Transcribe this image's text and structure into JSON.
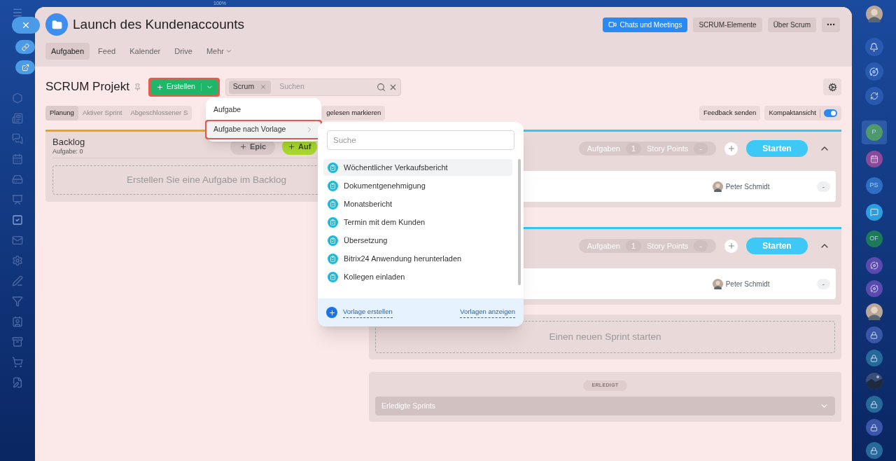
{
  "zoom_label": "100%",
  "project": {
    "title": "Launch des Kundenaccounts"
  },
  "header_buttons": [
    {
      "label": "Chats und Meetings",
      "kind": "primary"
    },
    {
      "label": "SCRUM-Elemente",
      "kind": "plain"
    },
    {
      "label": "Über Scrum",
      "kind": "plain"
    }
  ],
  "nav_tabs": [
    {
      "label": "Aufgaben",
      "selected": true,
      "dropdown": false
    },
    {
      "label": "Feed",
      "selected": false,
      "dropdown": false
    },
    {
      "label": "Kalender",
      "selected": false,
      "dropdown": false
    },
    {
      "label": "Drive",
      "selected": false,
      "dropdown": false
    },
    {
      "label": "Mehr",
      "selected": false,
      "dropdown": true
    }
  ],
  "page_title": "SCRUM Projekt",
  "create_button": {
    "label": "Erstellen",
    "highlighted": true
  },
  "search": {
    "filter_tag": "Scrum",
    "placeholder": "Suchen"
  },
  "view_tabs": [
    {
      "label": "Planung",
      "selected": true
    },
    {
      "label": "Aktiver Sprint",
      "selected": false
    },
    {
      "label": "Abgeschlossener S",
      "selected": false
    }
  ],
  "mark_read_button": "gelesen markieren",
  "feedback_button": "Feedback senden",
  "compact_view": {
    "label": "Kompaktansicht",
    "on": true
  },
  "backlog": {
    "title": "Backlog",
    "count_label": "Aufgabe: 0",
    "buttons": [
      "Epic",
      "Auf"
    ],
    "empty_text": "Erstellen Sie eine Aufgabe im Backlog"
  },
  "sprints": [
    {
      "stats": [
        {
          "label": "Aufgaben",
          "value": "1"
        },
        {
          "label": "Story Points",
          "value": "-"
        }
      ],
      "start_label": "Starten",
      "expanded": true,
      "tasks": [
        {
          "assignee": "Peter Schmidt",
          "points": "-"
        }
      ]
    },
    {
      "stats": [
        {
          "label": "Aufgaben",
          "value": "1"
        },
        {
          "label": "Story Points",
          "value": "-"
        }
      ],
      "start_label": "Starten",
      "expanded": true,
      "tasks": [
        {
          "assignee": "Peter Schmidt",
          "points": "-"
        }
      ]
    }
  ],
  "new_sprint": "Einen neuen Sprint starten",
  "done": {
    "badge": "ERLEDIGT",
    "label": "Erledigte Sprints",
    "expanded": false
  },
  "menu": {
    "items": [
      {
        "label": "Aufgabe",
        "selected": false,
        "submenu": false,
        "highlighted": false
      },
      {
        "label": "Aufgabe nach Vorlage",
        "selected": true,
        "submenu": true,
        "highlighted": true
      }
    ]
  },
  "template_popup": {
    "placeholder": "Suche",
    "items": [
      {
        "label": "Wöchentlicher Verkaufsbericht",
        "selected": true
      },
      {
        "label": "Dokumentgenehmigung",
        "selected": false
      },
      {
        "label": "Monatsbericht",
        "selected": false
      },
      {
        "label": "Termin mit dem Kunden",
        "selected": false
      },
      {
        "label": "Übersetzung",
        "selected": false
      },
      {
        "label": "Bitrix24 Anwendung herunterladen",
        "selected": false
      },
      {
        "label": "Kollegen einladen",
        "selected": false
      }
    ],
    "create_link": "Vorlage erstellen",
    "show_link": "Vorlagen anzeigen"
  },
  "rail_badges": [
    {
      "text": "P",
      "color": "#4e9a6a",
      "selected": true
    },
    {
      "text": "PS",
      "color": "#2f6fc2",
      "selected": false
    },
    {
      "text": "OF",
      "color": "#1d7a58",
      "selected": false
    }
  ]
}
